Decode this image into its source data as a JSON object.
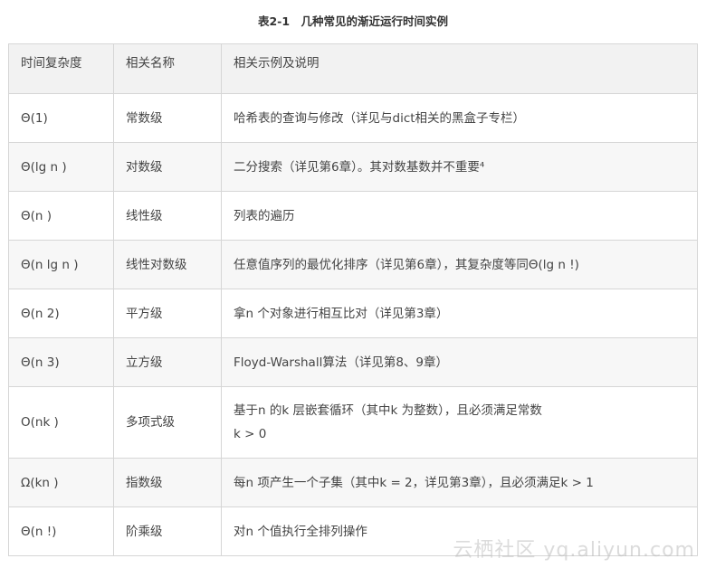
{
  "caption": "表2-1　几种常见的渐近运行时间实例",
  "headers": [
    "时间复杂度",
    "相关名称",
    "相关示例及说明"
  ],
  "rows": [
    {
      "complexity": "Θ(1)",
      "name": "常数级",
      "desc": [
        "哈希表的查询与修改（详见与dict相关的黑盒子专栏）"
      ]
    },
    {
      "complexity": "Θ(lg n )",
      "name": "对数级",
      "desc": [
        "二分搜索（详见第6章）。其对数基数并不重要⁴"
      ]
    },
    {
      "complexity": "Θ(n )",
      "name": "线性级",
      "desc": [
        "列表的遍历"
      ]
    },
    {
      "complexity": "Θ(n lg n )",
      "name": "线性对数级",
      "desc": [
        "任意值序列的最优化排序（详见第6章），其复杂度等同Θ(lg n !)"
      ]
    },
    {
      "complexity": "Θ(n 2)",
      "name": "平方级",
      "desc": [
        "拿n 个对象进行相互比对（详见第3章）"
      ]
    },
    {
      "complexity": "Θ(n 3)",
      "name": "立方级",
      "desc": [
        "Floyd-Warshall算法（详见第8、9章）"
      ]
    },
    {
      "complexity": "O(nk )",
      "name": "多项式级",
      "desc": [
        "基于n 的k 层嵌套循环（其中k 为整数），且必须满足常数",
        "k > 0"
      ]
    },
    {
      "complexity": "Ω(kn )",
      "name": "指数级",
      "desc": [
        "每n 项产生一个子集（其中k = 2，详见第3章），且必须满足k > 1"
      ]
    },
    {
      "complexity": "Θ(n !)",
      "name": "阶乘级",
      "desc": [
        "对n 个值执行全排列操作"
      ]
    }
  ],
  "watermark": "云栖社区 yq.aliyun.com"
}
